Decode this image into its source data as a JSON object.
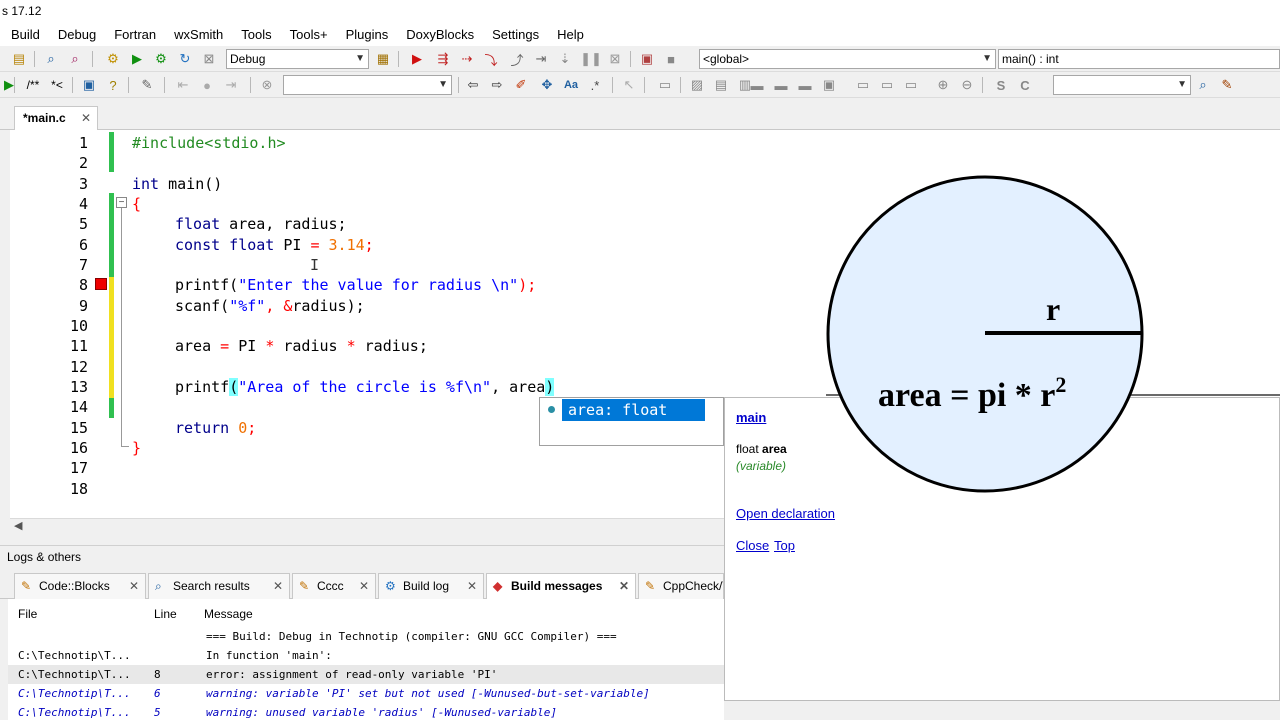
{
  "window": {
    "title": "s 17.12"
  },
  "menu": [
    "Build",
    "Debug",
    "Fortran",
    "wxSmith",
    "Tools",
    "Tools+",
    "Plugins",
    "DoxyBlocks",
    "Settings",
    "Help"
  ],
  "toolbar": {
    "build_target": "Debug",
    "scope": "<global>",
    "function": "main() : int",
    "comment_btn": "/**",
    "comment_btn2": "*<"
  },
  "editor": {
    "tab_label": "*main.c",
    "lines": [
      {
        "n": "1"
      },
      {
        "n": "2"
      },
      {
        "n": "3"
      },
      {
        "n": "4"
      },
      {
        "n": "5"
      },
      {
        "n": "6"
      },
      {
        "n": "7"
      },
      {
        "n": "8"
      },
      {
        "n": "9"
      },
      {
        "n": "10"
      },
      {
        "n": "11"
      },
      {
        "n": "12"
      },
      {
        "n": "13"
      },
      {
        "n": "14"
      },
      {
        "n": "15"
      },
      {
        "n": "16"
      },
      {
        "n": "17"
      },
      {
        "n": "18"
      }
    ],
    "code": {
      "l1": "#include<stdio.h>",
      "l3_kw": "int",
      "l3_rest": " main()",
      "l4": "{",
      "l5_kw": "float",
      "l5_rest": " area, radius;",
      "l6_kw": "const float",
      "l6_mid": " PI ",
      "l6_op": "=",
      "l6_num": " 3.14",
      "l6_end": ";",
      "l8_fn": "printf(",
      "l8_str": "\"Enter the value for radius \\n\"",
      "l8_end": ");",
      "l9_fn": "scanf(",
      "l9_str": "\"%f\"",
      "l9_mid": ", ",
      "l9_op": "&",
      "l9_end": "radius);",
      "l11_a": "area ",
      "l11_op1": "=",
      "l11_b": " PI ",
      "l11_op2": "*",
      "l11_c": " radius ",
      "l11_op3": "*",
      "l11_d": " radius;",
      "l13_fn": "printf",
      "l13_p": "(",
      "l13_str": "\"Area of the circle is %f\\n\"",
      "l13_mid": ", area",
      "l13_p2": ")",
      "l15_kw": "return",
      "l15_num": " 0",
      "l15_end": ";",
      "l16": "}"
    }
  },
  "autocomplete": {
    "item": "area: float"
  },
  "doc_popup": {
    "scope_link": "main",
    "decl_type": "float ",
    "decl_name": "area",
    "kind": "(variable)",
    "open_decl": "Open declaration",
    "close": "Close",
    "top": "Top"
  },
  "overlay": {
    "radius_label": "r",
    "formula": "area = pi * r",
    "exponent": "2",
    "fill_color": "#e3f0ff"
  },
  "logs": {
    "header": "Logs & others",
    "tabs": [
      {
        "label": "Code::Blocks",
        "icon": "pencil-icon"
      },
      {
        "label": "Search results",
        "icon": "search-icon"
      },
      {
        "label": "Cccc",
        "icon": "pencil-icon"
      },
      {
        "label": "Build log",
        "icon": "gear-icon"
      },
      {
        "label": "Build messages",
        "icon": "diamond-icon",
        "active": true
      },
      {
        "label": "CppCheck/V",
        "icon": "pencil-icon"
      }
    ],
    "columns": {
      "file": "File",
      "line": "Line",
      "message": "Message"
    },
    "rows": [
      {
        "file": "",
        "line": "",
        "message": "=== Build: Debug in Technotip (compiler: GNU GCC Compiler) ===",
        "type": "info"
      },
      {
        "file": "C:\\Technotip\\T...",
        "line": "",
        "message": "In function 'main':",
        "type": "info"
      },
      {
        "file": "C:\\Technotip\\T...",
        "line": "8",
        "message": "error: assignment of read-only variable 'PI'",
        "type": "error"
      },
      {
        "file": "C:\\Technotip\\T...",
        "line": "6",
        "message": "warning: variable 'PI' set but not used [-Wunused-but-set-variable]",
        "type": "warning"
      },
      {
        "file": "C:\\Technotip\\T...",
        "line": "5",
        "message": "warning: unused variable 'radius' [-Wunused-variable]",
        "type": "warning"
      }
    ]
  }
}
